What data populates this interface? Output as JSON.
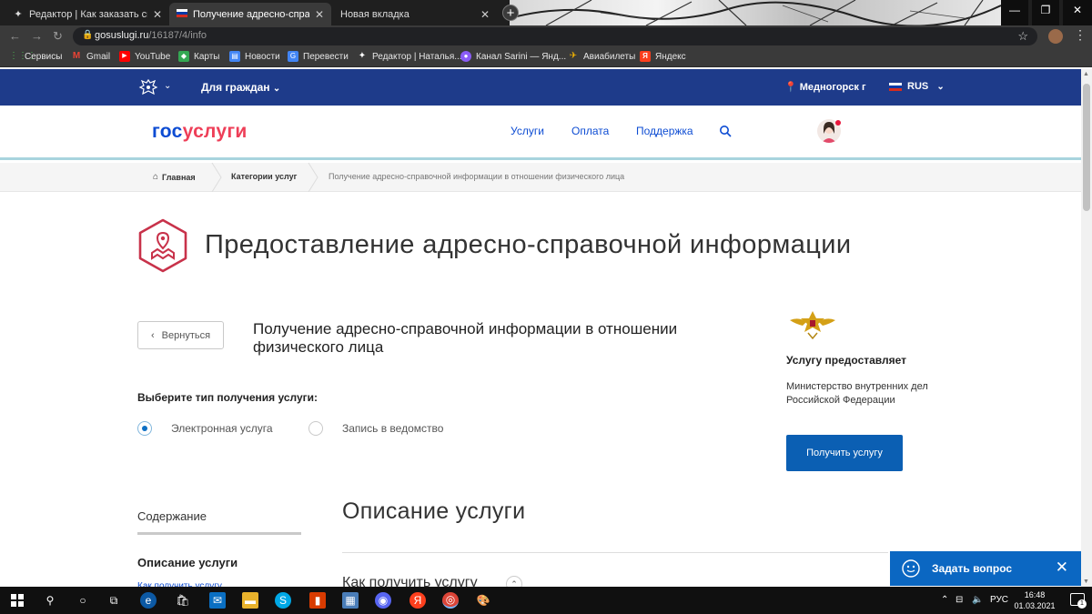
{
  "browser": {
    "tabs": [
      {
        "label": "Редактор | Как заказать справку",
        "active": false
      },
      {
        "label": "Получение адресно-справочной",
        "active": true
      },
      {
        "label": "Новая вкладка",
        "active": false
      }
    ],
    "url_host": "gosuslugi.ru",
    "url_path": "/16187/4/info",
    "bookmarks": [
      {
        "label": "Сервисы",
        "icon": "apps-icon",
        "color": "#4caf50"
      },
      {
        "label": "Gmail",
        "icon": "gmail-icon",
        "color": "#ea4335"
      },
      {
        "label": "YouTube",
        "icon": "youtube-icon",
        "color": "#ff0000"
      },
      {
        "label": "Карты",
        "icon": "maps-icon",
        "color": "#34a853"
      },
      {
        "label": "Новости",
        "icon": "news-icon",
        "color": "#4285f4"
      },
      {
        "label": "Перевести",
        "icon": "translate-icon",
        "color": "#4285f4"
      },
      {
        "label": "Редактор | Наталья...",
        "icon": "editor-icon",
        "color": "#ffffff"
      },
      {
        "label": "Канал Sarini — Янд...",
        "icon": "zen-icon",
        "color": "#8a5cf6"
      },
      {
        "label": "Авиабилеты",
        "icon": "plane-icon",
        "color": "#f5b400"
      },
      {
        "label": "Яндекс",
        "icon": "yandex-icon",
        "color": "#fc3f1d"
      }
    ]
  },
  "topbar": {
    "for_citizens": "Для граждан",
    "city": "Медногорск г",
    "lang": "RUS"
  },
  "header": {
    "logo_a": "гос",
    "logo_b": "услуги",
    "nav": [
      "Услуги",
      "Оплата",
      "Поддержка"
    ]
  },
  "breadcrumb": {
    "home": "Главная",
    "categories": "Категории услуг",
    "current": "Получение адресно-справочной информации в отношении физического лица"
  },
  "main": {
    "page_title": "Предоставление адресно-справочной информации",
    "back_label": "Вернуться",
    "sub_title": "Получение адресно-справочной информации в отношении физического лица",
    "choose_label": "Выберите тип получения услуги:",
    "options": [
      {
        "label": "Электронная услуга",
        "selected": true
      },
      {
        "label": "Запись в ведомство",
        "selected": false
      }
    ],
    "provider_head": "Услугу предоставляет",
    "provider_name": "Министерство внутренних дел Российской Федерации",
    "get_service": "Получить услугу",
    "toc_head": "Содержание",
    "toc_item_1": "Описание услуги",
    "toc_item_2": "Как получить услугу",
    "desc_head": "Описание услуги",
    "how_head": "Как получить услугу"
  },
  "ask_widget": {
    "label": "Задать вопрос"
  },
  "taskbar": {
    "lang": "РУС",
    "time": "16:48",
    "date": "01.03.2021",
    "notifications": "1"
  },
  "colors": {
    "gov_blue": "#1e3b8a",
    "link_blue": "#0d4cd3",
    "logo_red": "#ee3f58",
    "button_blue": "#0b5fb3"
  }
}
